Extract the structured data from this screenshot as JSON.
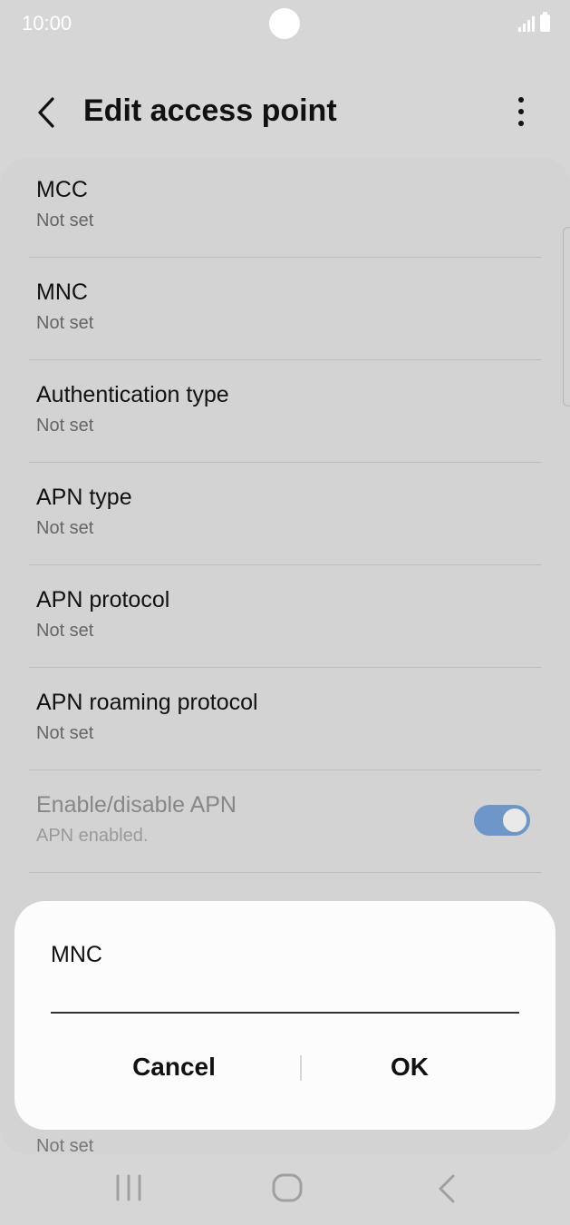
{
  "status_bar": {
    "time": "10:00",
    "icons": [
      "signal-icon",
      "battery-icon"
    ]
  },
  "app_bar": {
    "title": "Edit access point",
    "icons": [
      "back-icon",
      "more-options-icon"
    ]
  },
  "settings": [
    {
      "title": "MCC",
      "value": "Not set"
    },
    {
      "title": "MNC",
      "value": "Not set"
    },
    {
      "title": "Authentication type",
      "value": "Not set"
    },
    {
      "title": "APN type",
      "value": "Not set"
    },
    {
      "title": "APN protocol",
      "value": "Not set"
    },
    {
      "title": "APN roaming protocol",
      "value": "Not set"
    },
    {
      "title": "Enable/disable APN",
      "value": "APN enabled.",
      "toggle_on": true,
      "disabled": true
    }
  ],
  "hidden_item_value": "Not set",
  "dialog": {
    "title": "MNC",
    "input_value": "",
    "cancel_label": "Cancel",
    "ok_label": "OK"
  },
  "nav_bar": {
    "icons": [
      "recent-apps-icon",
      "home-icon",
      "back-nav-icon"
    ]
  },
  "colors": {
    "background": "#d6d6d6",
    "dialog": "#fcfcfc",
    "toggle_accent": "#6e96c7"
  }
}
